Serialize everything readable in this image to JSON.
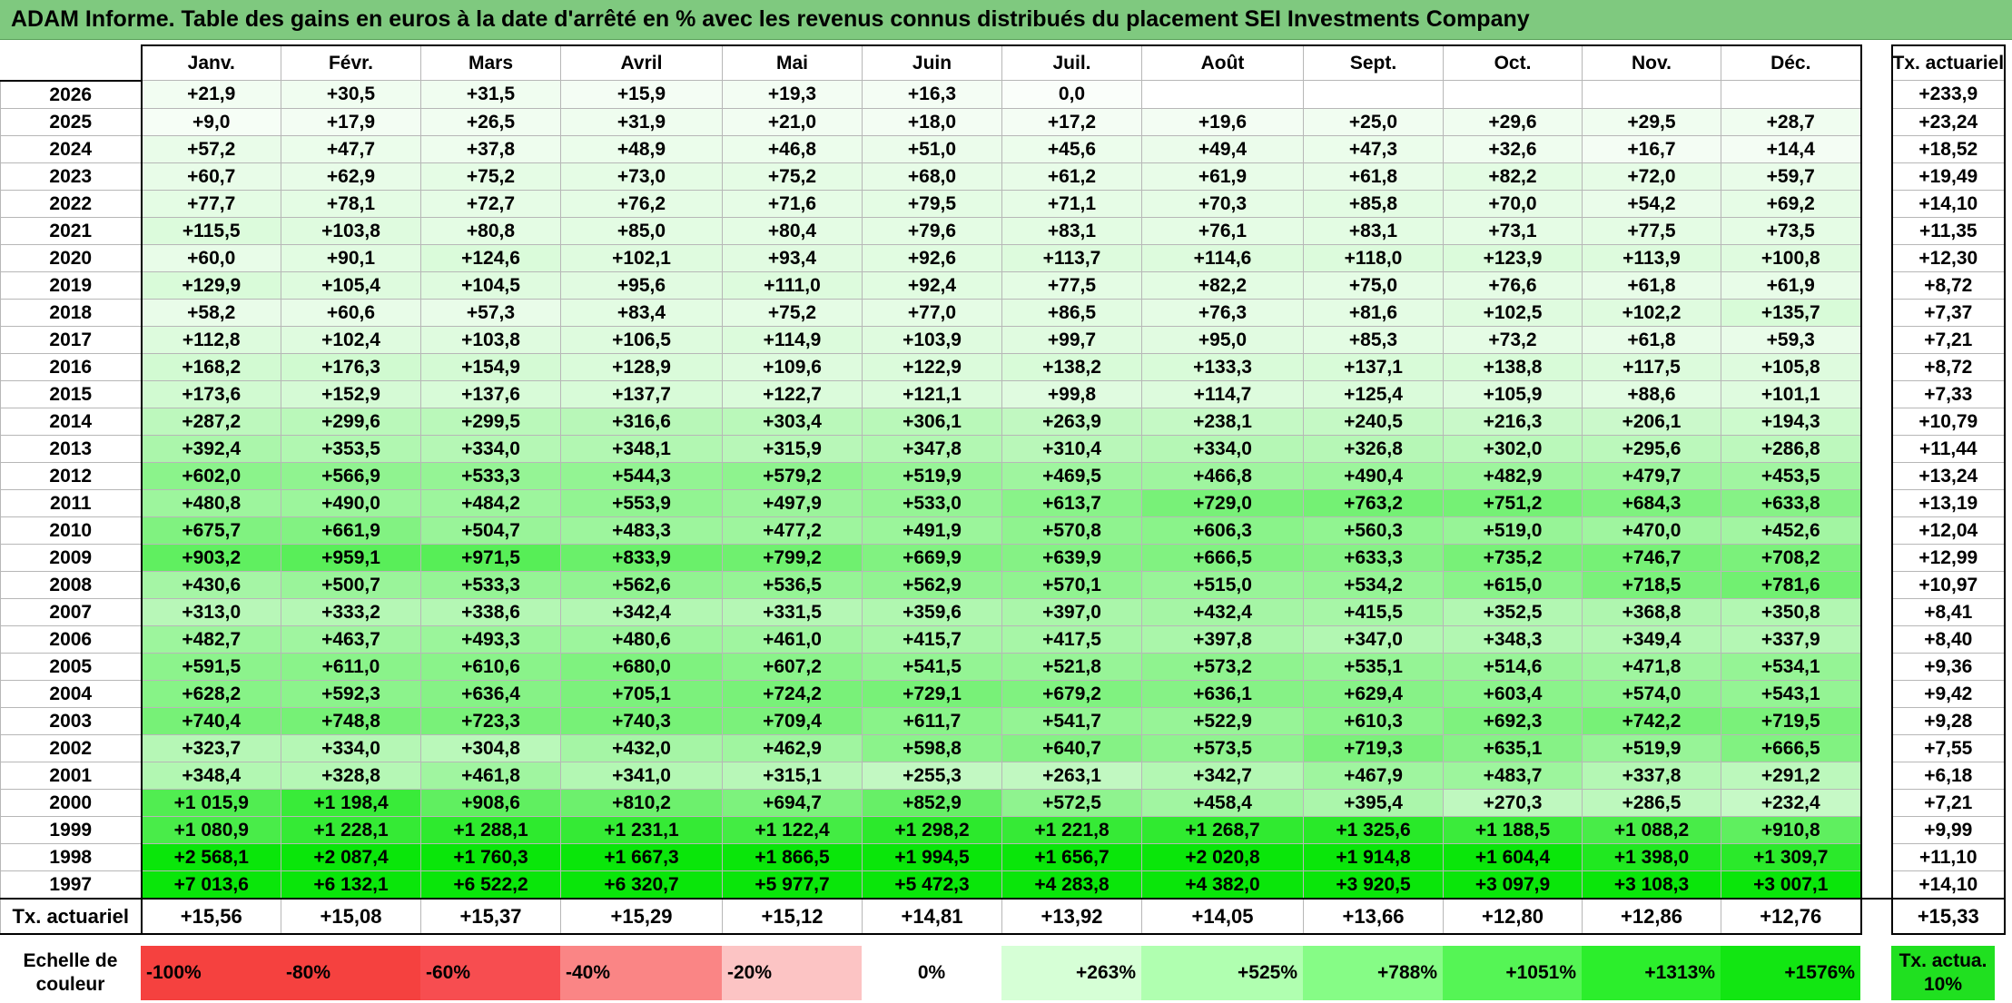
{
  "title": "ADAM Informe. Table des gains en euros à la date d'arrêté en % avec les revenus connus distribués du placement SEI Investments Company",
  "months": [
    "Janv.",
    "Févr.",
    "Mars",
    "Avril",
    "Mai",
    "Juin",
    "Juil.",
    "Août",
    "Sept.",
    "Oct.",
    "Nov.",
    "Déc."
  ],
  "actuarial_header": "Tx. actuariel",
  "rows": [
    {
      "year": "2026",
      "values": [
        "+21,9",
        "+30,5",
        "+31,5",
        "+15,9",
        "+19,3",
        "+16,3",
        "0,0",
        "",
        "",
        "",
        "",
        ""
      ],
      "rate": "+233,9"
    },
    {
      "year": "2025",
      "values": [
        "+9,0",
        "+17,9",
        "+26,5",
        "+31,9",
        "+21,0",
        "+18,0",
        "+17,2",
        "+19,6",
        "+25,0",
        "+29,6",
        "+29,5",
        "+28,7"
      ],
      "rate": "+23,24"
    },
    {
      "year": "2024",
      "values": [
        "+57,2",
        "+47,7",
        "+37,8",
        "+48,9",
        "+46,8",
        "+51,0",
        "+45,6",
        "+49,4",
        "+47,3",
        "+32,6",
        "+16,7",
        "+14,4"
      ],
      "rate": "+18,52"
    },
    {
      "year": "2023",
      "values": [
        "+60,7",
        "+62,9",
        "+75,2",
        "+73,0",
        "+75,2",
        "+68,0",
        "+61,2",
        "+61,9",
        "+61,8",
        "+82,2",
        "+72,0",
        "+59,7"
      ],
      "rate": "+19,49"
    },
    {
      "year": "2022",
      "values": [
        "+77,7",
        "+78,1",
        "+72,7",
        "+76,2",
        "+71,6",
        "+79,5",
        "+71,1",
        "+70,3",
        "+85,8",
        "+70,0",
        "+54,2",
        "+69,2"
      ],
      "rate": "+14,10"
    },
    {
      "year": "2021",
      "values": [
        "+115,5",
        "+103,8",
        "+80,8",
        "+85,0",
        "+80,4",
        "+79,6",
        "+83,1",
        "+76,1",
        "+83,1",
        "+73,1",
        "+77,5",
        "+73,5"
      ],
      "rate": "+11,35"
    },
    {
      "year": "2020",
      "values": [
        "+60,0",
        "+90,1",
        "+124,6",
        "+102,1",
        "+93,4",
        "+92,6",
        "+113,7",
        "+114,6",
        "+118,0",
        "+123,9",
        "+113,9",
        "+100,8"
      ],
      "rate": "+12,30"
    },
    {
      "year": "2019",
      "values": [
        "+129,9",
        "+105,4",
        "+104,5",
        "+95,6",
        "+111,0",
        "+92,4",
        "+77,5",
        "+82,2",
        "+75,0",
        "+76,6",
        "+61,8",
        "+61,9"
      ],
      "rate": "+8,72"
    },
    {
      "year": "2018",
      "values": [
        "+58,2",
        "+60,6",
        "+57,3",
        "+83,4",
        "+75,2",
        "+77,0",
        "+86,5",
        "+76,3",
        "+81,6",
        "+102,5",
        "+102,2",
        "+135,7"
      ],
      "rate": "+7,37"
    },
    {
      "year": "2017",
      "values": [
        "+112,8",
        "+102,4",
        "+103,8",
        "+106,5",
        "+114,9",
        "+103,9",
        "+99,7",
        "+95,0",
        "+85,3",
        "+73,2",
        "+61,8",
        "+59,3"
      ],
      "rate": "+7,21"
    },
    {
      "year": "2016",
      "values": [
        "+168,2",
        "+176,3",
        "+154,9",
        "+128,9",
        "+109,6",
        "+122,9",
        "+138,2",
        "+133,3",
        "+137,1",
        "+138,8",
        "+117,5",
        "+105,8"
      ],
      "rate": "+8,72"
    },
    {
      "year": "2015",
      "values": [
        "+173,6",
        "+152,9",
        "+137,6",
        "+137,7",
        "+122,7",
        "+121,1",
        "+99,8",
        "+114,7",
        "+125,4",
        "+105,9",
        "+88,6",
        "+101,1"
      ],
      "rate": "+7,33"
    },
    {
      "year": "2014",
      "values": [
        "+287,2",
        "+299,6",
        "+299,5",
        "+316,6",
        "+303,4",
        "+306,1",
        "+263,9",
        "+238,1",
        "+240,5",
        "+216,3",
        "+206,1",
        "+194,3"
      ],
      "rate": "+10,79"
    },
    {
      "year": "2013",
      "values": [
        "+392,4",
        "+353,5",
        "+334,0",
        "+348,1",
        "+315,9",
        "+347,8",
        "+310,4",
        "+334,0",
        "+326,8",
        "+302,0",
        "+295,6",
        "+286,8"
      ],
      "rate": "+11,44"
    },
    {
      "year": "2012",
      "values": [
        "+602,0",
        "+566,9",
        "+533,3",
        "+544,3",
        "+579,2",
        "+519,9",
        "+469,5",
        "+466,8",
        "+490,4",
        "+482,9",
        "+479,7",
        "+453,5"
      ],
      "rate": "+13,24"
    },
    {
      "year": "2011",
      "values": [
        "+480,8",
        "+490,0",
        "+484,2",
        "+553,9",
        "+497,9",
        "+533,0",
        "+613,7",
        "+729,0",
        "+763,2",
        "+751,2",
        "+684,3",
        "+633,8"
      ],
      "rate": "+13,19"
    },
    {
      "year": "2010",
      "values": [
        "+675,7",
        "+661,9",
        "+504,7",
        "+483,3",
        "+477,2",
        "+491,9",
        "+570,8",
        "+606,3",
        "+560,3",
        "+519,0",
        "+470,0",
        "+452,6"
      ],
      "rate": "+12,04"
    },
    {
      "year": "2009",
      "values": [
        "+903,2",
        "+959,1",
        "+971,5",
        "+833,9",
        "+799,2",
        "+669,9",
        "+639,9",
        "+666,5",
        "+633,3",
        "+735,2",
        "+746,7",
        "+708,2"
      ],
      "rate": "+12,99"
    },
    {
      "year": "2008",
      "values": [
        "+430,6",
        "+500,7",
        "+533,3",
        "+562,6",
        "+536,5",
        "+562,9",
        "+570,1",
        "+515,0",
        "+534,2",
        "+615,0",
        "+718,5",
        "+781,6"
      ],
      "rate": "+10,97"
    },
    {
      "year": "2007",
      "values": [
        "+313,0",
        "+333,2",
        "+338,6",
        "+342,4",
        "+331,5",
        "+359,6",
        "+397,0",
        "+432,4",
        "+415,5",
        "+352,5",
        "+368,8",
        "+350,8"
      ],
      "rate": "+8,41"
    },
    {
      "year": "2006",
      "values": [
        "+482,7",
        "+463,7",
        "+493,3",
        "+480,6",
        "+461,0",
        "+415,7",
        "+417,5",
        "+397,8",
        "+347,0",
        "+348,3",
        "+349,4",
        "+337,9"
      ],
      "rate": "+8,40"
    },
    {
      "year": "2005",
      "values": [
        "+591,5",
        "+611,0",
        "+610,6",
        "+680,0",
        "+607,2",
        "+541,5",
        "+521,8",
        "+573,2",
        "+535,1",
        "+514,6",
        "+471,8",
        "+534,1"
      ],
      "rate": "+9,36"
    },
    {
      "year": "2004",
      "values": [
        "+628,2",
        "+592,3",
        "+636,4",
        "+705,1",
        "+724,2",
        "+729,1",
        "+679,2",
        "+636,1",
        "+629,4",
        "+603,4",
        "+574,0",
        "+543,1"
      ],
      "rate": "+9,42"
    },
    {
      "year": "2003",
      "values": [
        "+740,4",
        "+748,8",
        "+723,3",
        "+740,3",
        "+709,4",
        "+611,7",
        "+541,7",
        "+522,9",
        "+610,3",
        "+692,3",
        "+742,2",
        "+719,5"
      ],
      "rate": "+9,28"
    },
    {
      "year": "2002",
      "values": [
        "+323,7",
        "+334,0",
        "+304,8",
        "+432,0",
        "+462,9",
        "+598,8",
        "+640,7",
        "+573,5",
        "+719,3",
        "+635,1",
        "+519,9",
        "+666,5"
      ],
      "rate": "+7,55"
    },
    {
      "year": "2001",
      "values": [
        "+348,4",
        "+328,8",
        "+461,8",
        "+341,0",
        "+315,1",
        "+255,3",
        "+263,1",
        "+342,7",
        "+467,9",
        "+483,7",
        "+337,8",
        "+291,2"
      ],
      "rate": "+6,18"
    },
    {
      "year": "2000",
      "values": [
        "+1 015,9",
        "+1 198,4",
        "+908,6",
        "+810,2",
        "+694,7",
        "+852,9",
        "+572,5",
        "+458,4",
        "+395,4",
        "+270,3",
        "+286,5",
        "+232,4"
      ],
      "rate": "+7,21"
    },
    {
      "year": "1999",
      "values": [
        "+1 080,9",
        "+1 228,1",
        "+1 288,1",
        "+1 231,1",
        "+1 122,4",
        "+1 298,2",
        "+1 221,8",
        "+1 268,7",
        "+1 325,6",
        "+1 188,5",
        "+1 088,2",
        "+910,8"
      ],
      "rate": "+9,99"
    },
    {
      "year": "1998",
      "values": [
        "+2 568,1",
        "+2 087,4",
        "+1 760,3",
        "+1 667,3",
        "+1 866,5",
        "+1 994,5",
        "+1 656,7",
        "+2 020,8",
        "+1 914,8",
        "+1 604,4",
        "+1 398,0",
        "+1 309,7"
      ],
      "rate": "+11,10"
    },
    {
      "year": "1997",
      "values": [
        "+7 013,6",
        "+6 132,1",
        "+6 522,2",
        "+6 320,7",
        "+5 977,7",
        "+5 472,3",
        "+4 283,8",
        "+4 382,0",
        "+3 920,5",
        "+3 097,9",
        "+3 108,3",
        "+3 007,1"
      ],
      "rate": "+14,10"
    }
  ],
  "summary": {
    "label": "Tx. actuariel",
    "values": [
      "+15,56",
      "+15,08",
      "+15,37",
      "+15,29",
      "+15,12",
      "+14,81",
      "+13,92",
      "+14,05",
      "+13,66",
      "+12,80",
      "+12,86",
      "+12,76"
    ],
    "rate": "+15,33"
  },
  "legend": {
    "label": "Echelle de couleur",
    "steps": [
      {
        "text": "-100%",
        "color": "#f5413f"
      },
      {
        "text": "-80%",
        "color": "#f5413f"
      },
      {
        "text": "-60%",
        "color": "#f74d50"
      },
      {
        "text": "-40%",
        "color": "#fa8585"
      },
      {
        "text": "-20%",
        "color": "#fcc4c4"
      },
      {
        "text": "0%",
        "color": "#ffffff"
      },
      {
        "text": "+263%",
        "color": "#d6ffd6"
      },
      {
        "text": "+525%",
        "color": "#b0ffb0"
      },
      {
        "text": "+788%",
        "color": "#86fc86"
      },
      {
        "text": "+1051%",
        "color": "#55f555"
      },
      {
        "text": "+1313%",
        "color": "#2cee2c"
      },
      {
        "text": "+1576%",
        "color": "#12e612"
      }
    ],
    "rate_label": "Tx. actua. 10%",
    "rate_color": "#20e020"
  },
  "colors": {
    "title_bg": "#7fc97f",
    "scale_max_pct": 1576
  }
}
